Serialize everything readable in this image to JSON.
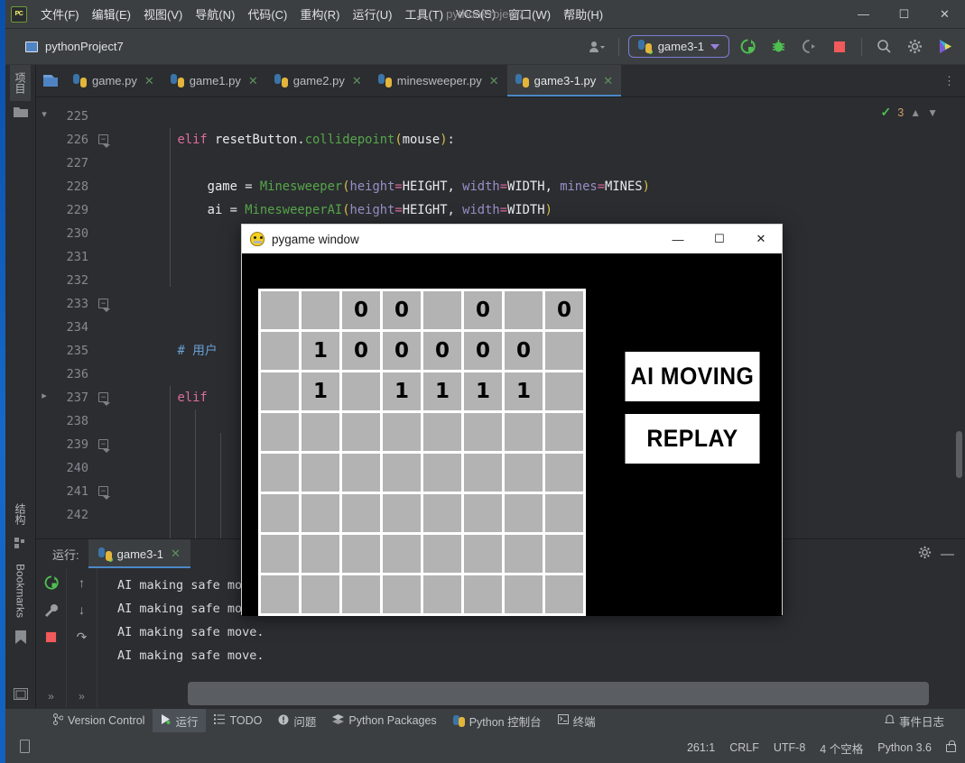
{
  "window": {
    "app_title": "pythonProject7",
    "menu": [
      "文件(F)",
      "编辑(E)",
      "视图(V)",
      "导航(N)",
      "代码(C)",
      "重构(R)",
      "运行(U)",
      "工具(T)",
      "VCS(S)",
      "窗口(W)",
      "帮助(H)"
    ],
    "minimize": "—",
    "maximize": "☐",
    "close": "✕"
  },
  "toolbar": {
    "project_name": "pythonProject7",
    "run_config": "game3-1",
    "icons": {
      "user": "user-icon",
      "run": "run-icon",
      "debug": "debug-icon",
      "coverage": "coverage-icon",
      "stop": "stop-icon",
      "search": "search-icon",
      "settings": "gear-icon",
      "assistant": "ai-assistant-icon"
    }
  },
  "leftstrip": {
    "project_tab": "项目",
    "structure_tab": "结构",
    "bookmarks_tab": "Bookmarks"
  },
  "tabs": [
    {
      "label": "game.py",
      "active": false
    },
    {
      "label": "game1.py",
      "active": false
    },
    {
      "label": "game2.py",
      "active": false
    },
    {
      "label": "minesweeper.py",
      "active": false
    },
    {
      "label": "game3-1.py",
      "active": true
    }
  ],
  "editor": {
    "inspection_count": "3",
    "line_numbers": [
      "225",
      "226",
      "227",
      "228",
      "229",
      "230",
      "231",
      "232",
      "233",
      "234",
      "235",
      "236",
      "237",
      "238",
      "239",
      "240",
      "241",
      "242"
    ],
    "lines": [
      {
        "num": "225",
        "segments": []
      },
      {
        "num": "226",
        "segments": [
          {
            "t": "        ",
            "c": "k-op"
          },
          {
            "t": "elif",
            "c": "kw-pink"
          },
          {
            "t": " resetButton",
            "c": "k-const"
          },
          {
            "t": ".",
            "c": "k-op"
          },
          {
            "t": "collidepoint",
            "c": "k-fn"
          },
          {
            "t": "(",
            "c": "k-yellow"
          },
          {
            "t": "mouse",
            "c": "k-const"
          },
          {
            "t": ")",
            "c": "k-yellow"
          },
          {
            "t": ":",
            "c": "k-op"
          }
        ]
      },
      {
        "num": "227",
        "segments": []
      },
      {
        "num": "228",
        "segments": [
          {
            "t": "            game ",
            "c": "k-const"
          },
          {
            "t": "=",
            "c": "k-op"
          },
          {
            "t": " ",
            "c": "k-op"
          },
          {
            "t": "Minesweeper",
            "c": "k-fn"
          },
          {
            "t": "(",
            "c": "k-yellow"
          },
          {
            "t": "height",
            "c": "k-arg"
          },
          {
            "t": "=",
            "c": "kw-pink"
          },
          {
            "t": "HEIGHT",
            "c": "k-const"
          },
          {
            "t": ", ",
            "c": "k-op"
          },
          {
            "t": "width",
            "c": "k-arg"
          },
          {
            "t": "=",
            "c": "kw-pink"
          },
          {
            "t": "WIDTH",
            "c": "k-const"
          },
          {
            "t": ", ",
            "c": "k-op"
          },
          {
            "t": "mines",
            "c": "k-arg"
          },
          {
            "t": "=",
            "c": "kw-pink"
          },
          {
            "t": "MINES",
            "c": "k-const"
          },
          {
            "t": ")",
            "c": "k-yellow"
          }
        ]
      },
      {
        "num": "229",
        "segments": [
          {
            "t": "            ai ",
            "c": "k-const"
          },
          {
            "t": "=",
            "c": "k-op"
          },
          {
            "t": " ",
            "c": "k-op"
          },
          {
            "t": "MinesweeperAI",
            "c": "k-fn"
          },
          {
            "t": "(",
            "c": "k-yellow"
          },
          {
            "t": "height",
            "c": "k-arg"
          },
          {
            "t": "=",
            "c": "kw-pink"
          },
          {
            "t": "HEIGHT",
            "c": "k-const"
          },
          {
            "t": ", ",
            "c": "k-op"
          },
          {
            "t": "width",
            "c": "k-arg"
          },
          {
            "t": "=",
            "c": "kw-pink"
          },
          {
            "t": "WIDTH",
            "c": "k-const"
          },
          {
            "t": ")",
            "c": "k-yellow"
          }
        ]
      },
      {
        "num": "230",
        "segments": []
      },
      {
        "num": "231",
        "segments": []
      },
      {
        "num": "232",
        "segments": []
      },
      {
        "num": "233",
        "segments": []
      },
      {
        "num": "234",
        "segments": []
      },
      {
        "num": "235",
        "segments": [
          {
            "t": "        ",
            "c": "k-op"
          },
          {
            "t": "# 用户",
            "c": "k-cmt"
          }
        ]
      },
      {
        "num": "236",
        "segments": []
      },
      {
        "num": "237",
        "segments": [
          {
            "t": "        ",
            "c": "k-op"
          },
          {
            "t": "elif",
            "c": "kw-pink"
          }
        ]
      },
      {
        "num": "238",
        "segments": []
      },
      {
        "num": "239",
        "segments": []
      },
      {
        "num": "240",
        "segments": []
      },
      {
        "num": "241",
        "segments": []
      },
      {
        "num": "242",
        "segments": []
      }
    ]
  },
  "run_panel": {
    "label": "运行:",
    "tab": "game3-1",
    "output": [
      "AI making safe move.",
      "AI making safe move.",
      "AI making safe move.",
      "AI making safe move."
    ]
  },
  "statusbar": {
    "items": [
      {
        "name": "version-control",
        "label": "Version Control",
        "icon": "branch-icon",
        "active": false
      },
      {
        "name": "run",
        "label": "运行",
        "icon": "play-icon",
        "active": true
      },
      {
        "name": "todo",
        "label": "TODO",
        "icon": "list-icon",
        "active": false
      },
      {
        "name": "problems",
        "label": "问题",
        "icon": "warning-icon",
        "active": false
      },
      {
        "name": "python-packages",
        "label": "Python Packages",
        "icon": "packages-icon",
        "active": false
      },
      {
        "name": "python-console",
        "label": "Python 控制台",
        "icon": "python-icon",
        "active": false
      },
      {
        "name": "terminal",
        "label": "终端",
        "icon": "terminal-icon",
        "active": false
      }
    ],
    "event_log": "事件日志",
    "caret": "261:1",
    "line_sep": "CRLF",
    "encoding": "UTF-8",
    "indent": "4 个空格",
    "interpreter": "Python 3.6"
  },
  "pygame": {
    "title": "pygame window",
    "minimize": "—",
    "maximize": "☐",
    "close": "✕",
    "status_button": "AI MOVING",
    "replay_button": "REPLAY",
    "grid": [
      [
        "",
        "",
        "0",
        "0",
        "",
        "0",
        "",
        "0"
      ],
      [
        "",
        "1",
        "0",
        "0",
        "0",
        "0",
        "0",
        ""
      ],
      [
        "",
        "1",
        "",
        "1",
        "1",
        "1",
        "1",
        ""
      ],
      [
        "",
        "",
        "",
        "",
        "",
        "",
        "",
        ""
      ],
      [
        "",
        "",
        "",
        "",
        "",
        "",
        "",
        ""
      ],
      [
        "",
        "",
        "",
        "",
        "",
        "",
        "",
        ""
      ],
      [
        "",
        "",
        "",
        "",
        "",
        "",
        "",
        ""
      ],
      [
        "",
        "",
        "",
        "",
        "",
        "",
        "",
        ""
      ]
    ],
    "colors": {
      "background": "#000000",
      "cell": "#b3b3b3",
      "grid_border": "#ffffff",
      "button_bg": "#ffffff",
      "button_fg": "#000000"
    }
  }
}
